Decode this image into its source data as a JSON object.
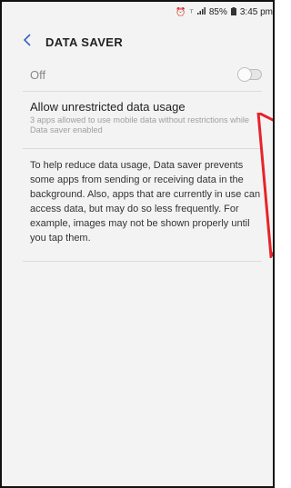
{
  "status_bar": {
    "battery_percent": "85%",
    "time": "3:45 pm",
    "icons": [
      "alarm-icon",
      "4g-icon",
      "signal-icon",
      "battery-icon"
    ]
  },
  "app_bar": {
    "title": "DATA SAVER",
    "back_icon": "chevron-left-icon"
  },
  "data_saver": {
    "state_label": "Off",
    "enabled": false
  },
  "unrestricted": {
    "title": "Allow unrestricted data usage",
    "subtitle": "3 apps allowed to use mobile data without restrictions while Data saver enabled"
  },
  "description": "To help reduce data usage, Data saver prevents some apps from sending or receiving data in the background. Also, apps that are currently in use can access data, but may do so less frequently. For example, images may not be shown properly until you tap them.",
  "colors": {
    "background": "#f3f3f3",
    "annotation": "#e8232a",
    "back_arrow": "#3a63b8"
  }
}
